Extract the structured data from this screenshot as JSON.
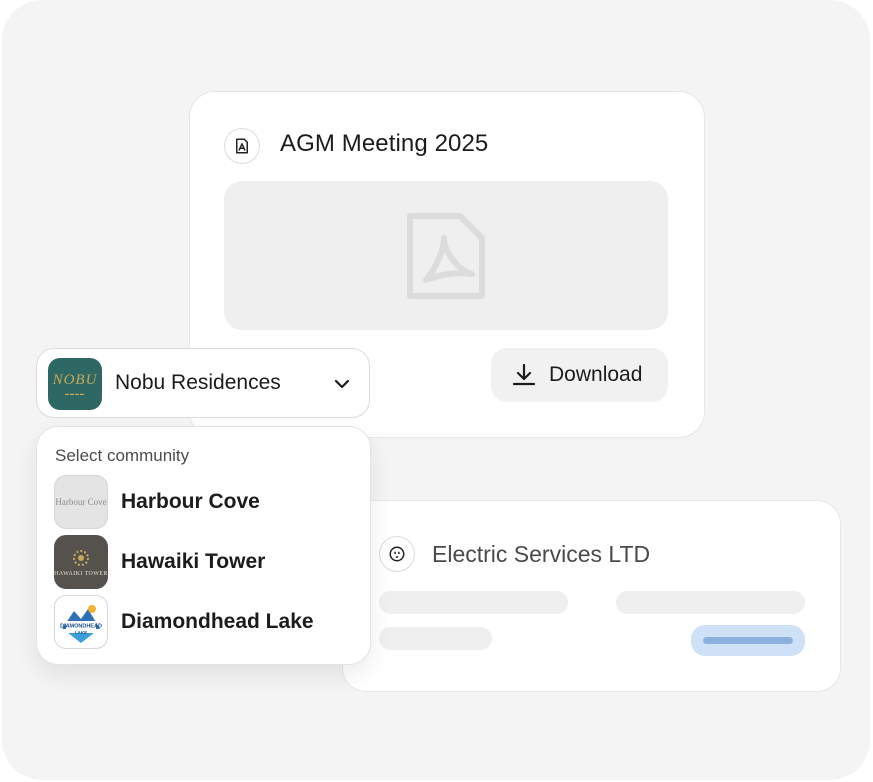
{
  "agm_card": {
    "title": "AGM Meeting 2025",
    "icon": "pdf-file-icon",
    "preview_icon": "pdf-placeholder-icon",
    "download_label": "Download"
  },
  "community_selector": {
    "selected": "Nobu Residences",
    "selected_logo_text": "NOBU",
    "heading": "Select community",
    "options": [
      {
        "label": "Harbour Cove",
        "logo_text": "Harbour Cove"
      },
      {
        "label": "Hawaiki Tower",
        "logo_text": "HAWAIKI TOWER"
      },
      {
        "label": "Diamondhead Lake",
        "logo_text": "DIAMONDHEAD LAKE"
      }
    ]
  },
  "vendor_card": {
    "title": "Electric Services LTD",
    "icon": "power-outlet-icon"
  },
  "colors": {
    "background": "#f4f4f4",
    "card": "#ffffff",
    "skeleton": "#efefef",
    "pill": "#cfe1f7",
    "pill_bar": "#8bb1dc",
    "nobu_teal": "#2d6865"
  }
}
